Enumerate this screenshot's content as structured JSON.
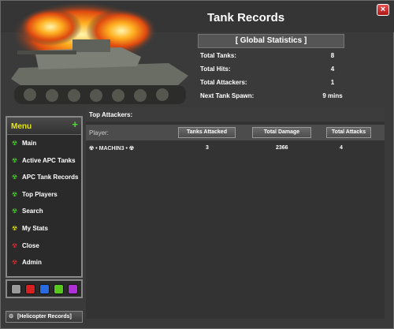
{
  "window": {
    "title": "Tank Records",
    "close_label": "×"
  },
  "global_stats": {
    "header": "[ Global Statistics ]",
    "rows": [
      {
        "label": "Total Tanks:",
        "value": "8"
      },
      {
        "label": "Total Hits:",
        "value": "4"
      },
      {
        "label": "Total Attackers:",
        "value": "1"
      },
      {
        "label": "Next Tank Spawn:",
        "value": "9 mins"
      }
    ]
  },
  "top_attackers": {
    "header": "Top Attackers:",
    "player_label": "Player:",
    "columns": [
      "Tanks Attacked",
      "Total Damage",
      "Total Attacks"
    ],
    "rows": [
      {
        "player": "☢ • MACHIN3 • ☢",
        "tanks_attacked": "3",
        "total_damage": "2366",
        "total_attacks": "4"
      }
    ]
  },
  "menu": {
    "title": "Menu",
    "plus": "+",
    "items": [
      {
        "label": "Main",
        "icon": "radiation-icon",
        "color": "#4fdc2f"
      },
      {
        "label": "Active APC Tanks",
        "icon": "radiation-icon",
        "color": "#4fdc2f"
      },
      {
        "label": "APC Tank Records",
        "icon": "radiation-icon",
        "color": "#4fdc2f"
      },
      {
        "label": "Top Players",
        "icon": "radiation-icon",
        "color": "#4fdc2f"
      },
      {
        "label": "Search",
        "icon": "radiation-icon",
        "color": "#4fdc2f"
      },
      {
        "label": "My Stats",
        "icon": "radiation-icon",
        "color": "#e8e800"
      },
      {
        "label": "Close",
        "icon": "radiation-icon",
        "color": "#e03030"
      },
      {
        "label": "Admin",
        "icon": "radiation-icon",
        "color": "#e03030"
      }
    ]
  },
  "color_swatches": [
    "#9a9a9a",
    "#d42020",
    "#2a6ae0",
    "#58c81e",
    "#b030d8"
  ],
  "helicopter_link": {
    "label": "[Helicopter Records]",
    "icon": "gear-icon"
  }
}
